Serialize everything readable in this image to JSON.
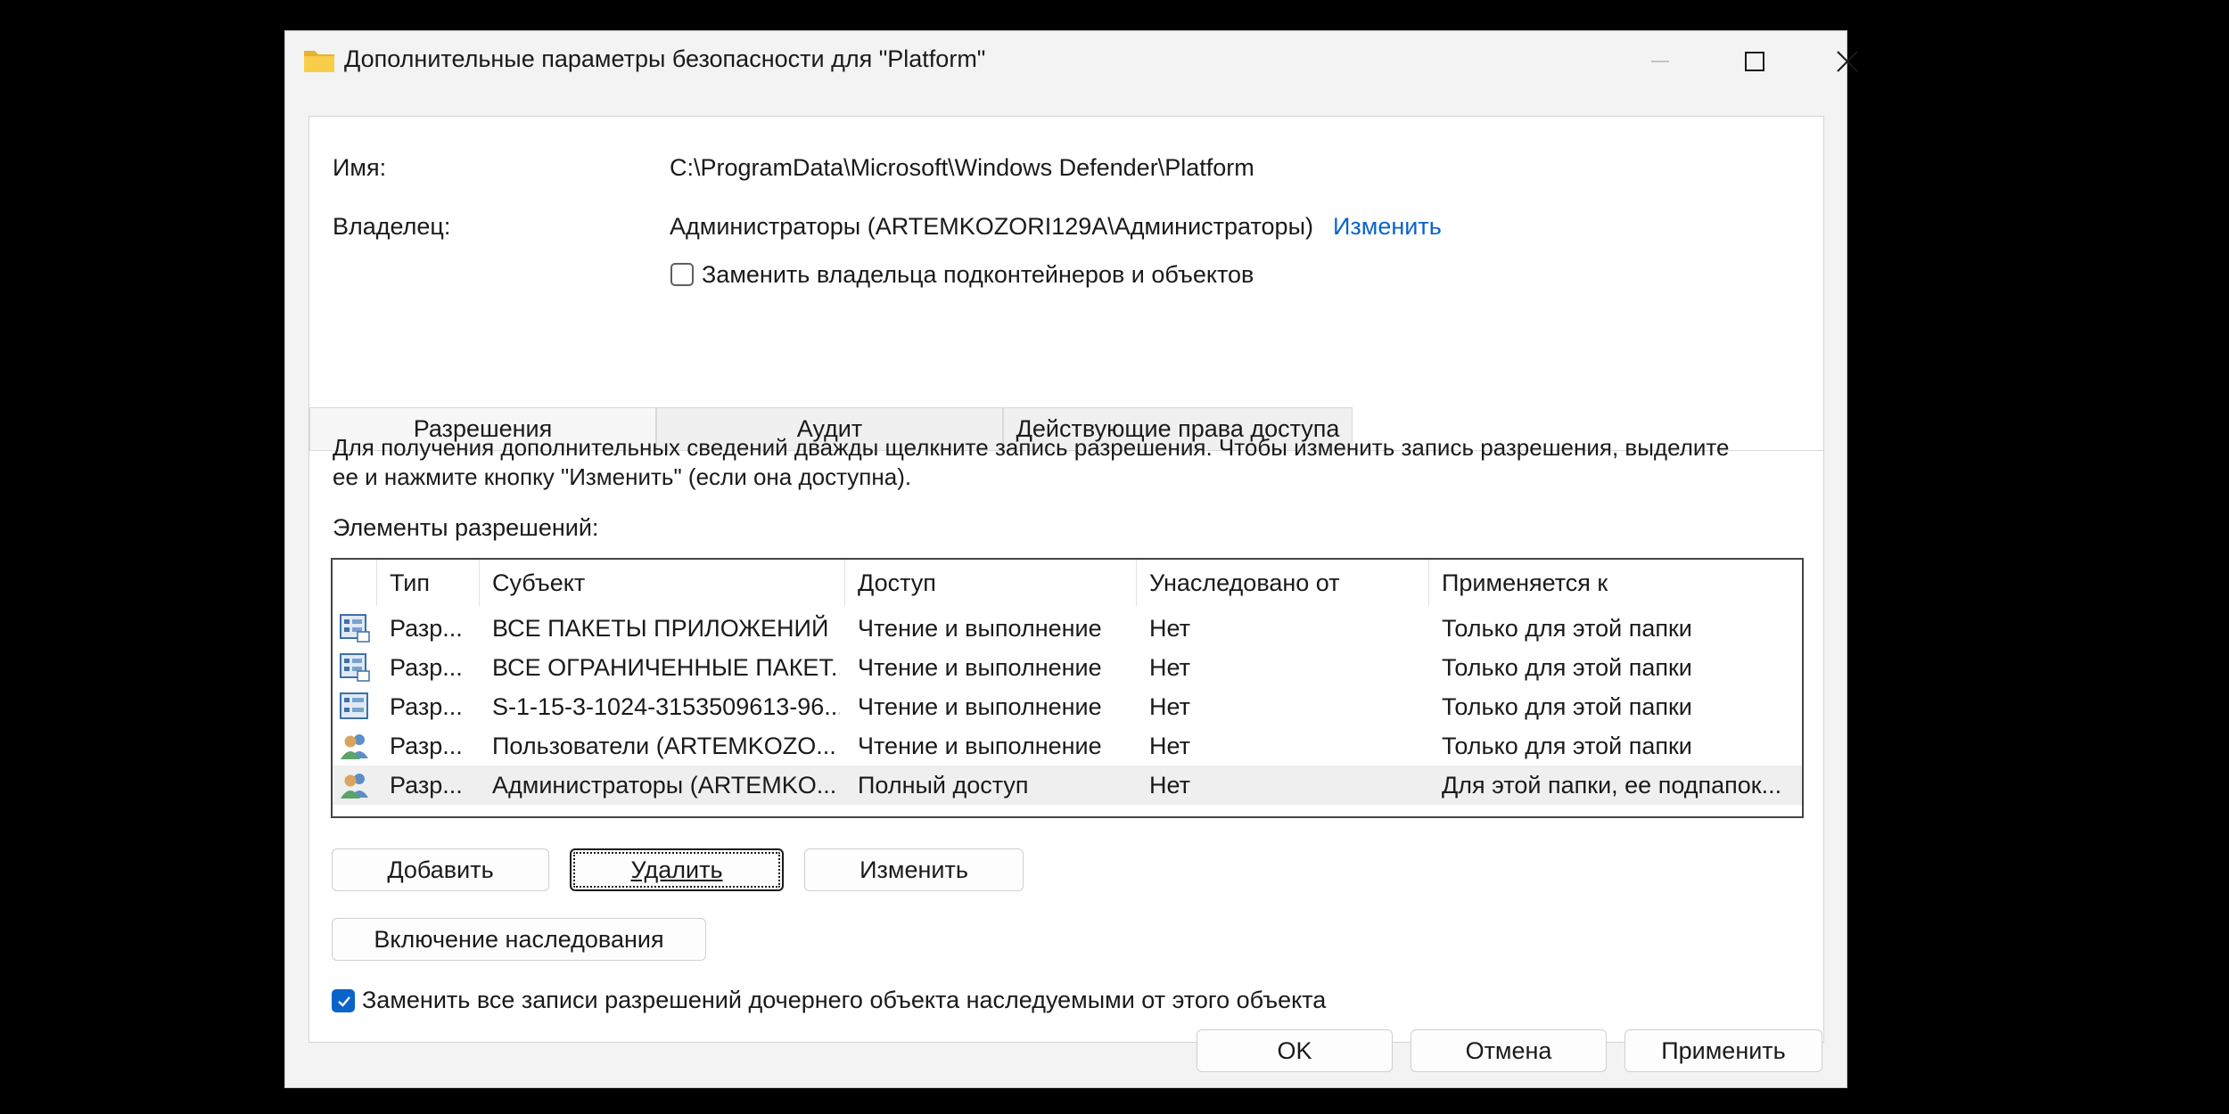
{
  "window": {
    "title": "Дополнительные параметры безопасности  для \"Platform\"",
    "title_icon": "folder-icon",
    "controls": [
      "minimize-icon",
      "maximize-icon",
      "close-icon"
    ]
  },
  "info": {
    "name_label": "Имя:",
    "name_value": "C:\\ProgramData\\Microsoft\\Windows Defender\\Platform",
    "owner_label": "Владелец:",
    "owner_value": "Администраторы (ARTEMKOZORI129A\\Администраторы)",
    "owner_change_link": "Изменить",
    "replace_owner_checkbox": {
      "label": "Заменить владельца подконтейнеров и объектов",
      "checked": false
    }
  },
  "tabs": [
    {
      "label": "Разрешения",
      "active": true
    },
    {
      "label": "Аудит",
      "active": false
    },
    {
      "label": "Действующие права доступа",
      "active": false
    }
  ],
  "permissions": {
    "description": "Для получения дополнительных сведений дважды щелкните запись разрешения. Чтобы изменить запись разрешения, выделите ее и нажмите кнопку \"Изменить\" (если она доступна).",
    "description_line1": "Для получения дополнительных сведений дважды щелкните запись разрешения. Чтобы изменить запись разрешения, выделите",
    "description_line2": "ее и нажмите кнопку \"Изменить\" (если она доступна).",
    "list_label": "Элементы разрешений:",
    "columns": [
      "Тип",
      "Субъект",
      "Доступ",
      "Унаследовано от",
      "Применяется к"
    ],
    "rows": [
      {
        "icon": "app-package-icon",
        "type": "Разр...",
        "principal": "ВСЕ ПАКЕТЫ ПРИЛОЖЕНИЙ",
        "access": "Чтение и выполнение",
        "inherited": "Нет",
        "applies": "Только для этой папки"
      },
      {
        "icon": "app-package-icon",
        "type": "Разр...",
        "principal": "ВСЕ ОГРАНИЧЕННЫЕ ПАКЕТ...",
        "access": "Чтение и выполнение",
        "inherited": "Нет",
        "applies": "Только для этой папки"
      },
      {
        "icon": "app-package-icon",
        "type": "Разр...",
        "principal": "S-1-15-3-1024-3153509613-96...",
        "access": "Чтение и выполнение",
        "inherited": "Нет",
        "applies": "Только для этой папки"
      },
      {
        "icon": "user-group-icon",
        "type": "Разр...",
        "principal": "Пользователи (ARTEMKOZO...",
        "access": "Чтение и выполнение",
        "inherited": "Нет",
        "applies": "Только для этой папки"
      },
      {
        "icon": "user-group-icon",
        "type": "Разр...",
        "principal": "Администраторы (ARTEMKO...",
        "access": "Полный доступ",
        "inherited": "Нет",
        "applies": "Для этой папки, ее подпапок...",
        "selected": true
      }
    ],
    "buttons": {
      "add": "Добавить",
      "remove": "Удалить",
      "edit": "Изменить"
    },
    "enable_inheritance": "Включение наследования",
    "replace_child_checkbox": {
      "label": "Заменить все записи разрешений дочернего объекта наследуемыми от этого объекта",
      "checked": true
    }
  },
  "footer": {
    "ok": "OK",
    "cancel": "Отмена",
    "apply": "Применить"
  },
  "colors": {
    "accent": "#0a63c9",
    "background": "#000000",
    "window": "#f3f3f3"
  }
}
